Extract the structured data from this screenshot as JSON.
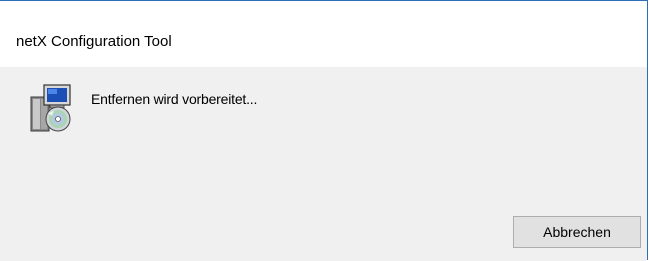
{
  "window": {
    "title": "netX Configuration Tool"
  },
  "dialog": {
    "icon": "installer-setup-icon",
    "status_text": "Entfernen wird vorbereitet...",
    "cancel_label": "Abbrechen"
  },
  "colors": {
    "window_border": "#2f6fb8",
    "titlebar_bg": "#ffffff",
    "client_bg": "#f0f0f0",
    "button_bg": "#e1e1e1",
    "button_border": "#adadad"
  }
}
